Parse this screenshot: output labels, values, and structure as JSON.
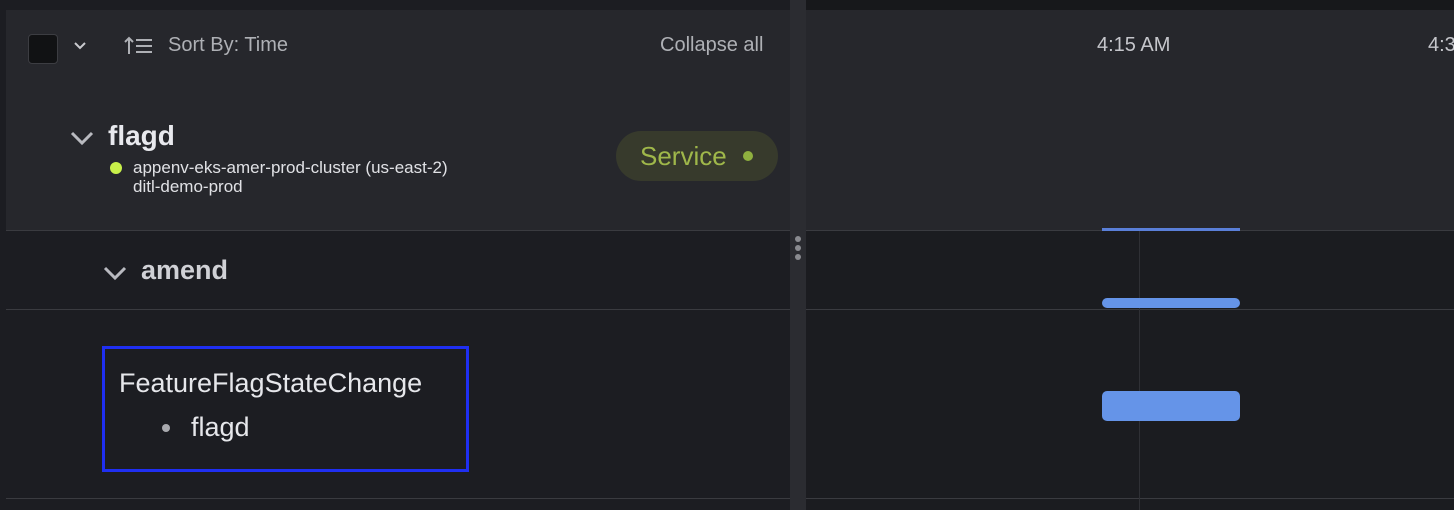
{
  "toolbar": {
    "sort_label": "Sort By: Time",
    "collapse_all_label": "Collapse all"
  },
  "timeline": {
    "ticks": [
      "4:15 AM",
      "4:3"
    ]
  },
  "service_group": {
    "title": "flagd",
    "cluster": "appenv-eks-amer-prod-cluster (us-east-2)",
    "namespace": "ditl-demo-prod",
    "badge_label": "Service",
    "status_color": "#c8f04a"
  },
  "operation_group": {
    "title": "amend"
  },
  "event": {
    "name": "FeatureFlagStateChange",
    "items": [
      "flagd"
    ]
  },
  "icons": [
    "checkbox",
    "chevron-down-icon",
    "sort-ascending-icon",
    "chevron-down-icon",
    "status-dot-icon",
    "drag-handle-icon"
  ]
}
